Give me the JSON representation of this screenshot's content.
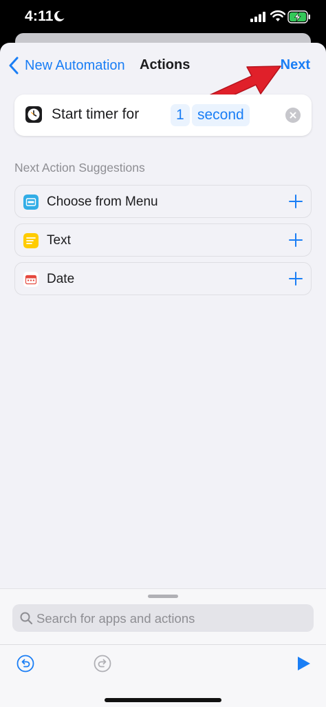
{
  "status_bar": {
    "time": "4:11",
    "icons": [
      "moon-icon",
      "signal-icon",
      "wifi-icon",
      "battery-charging-icon"
    ]
  },
  "nav": {
    "back_label": "New Automation",
    "title": "Actions",
    "next_label": "Next"
  },
  "action": {
    "prefix": "Start timer for",
    "count": "1",
    "unit": "second",
    "icon": "clock-icon"
  },
  "suggestions": {
    "header": "Next Action Suggestions",
    "items": [
      {
        "label": "Choose from Menu",
        "icon": "menu-icon",
        "color": "#32ade6"
      },
      {
        "label": "Text",
        "icon": "text-icon",
        "color": "#ffcc00"
      },
      {
        "label": "Date",
        "icon": "calendar-icon",
        "color": "#e5483e"
      }
    ]
  },
  "search": {
    "placeholder": "Search for apps and actions"
  },
  "colors": {
    "accent": "#1a7ef5",
    "annotation_arrow": "#e0202a"
  }
}
